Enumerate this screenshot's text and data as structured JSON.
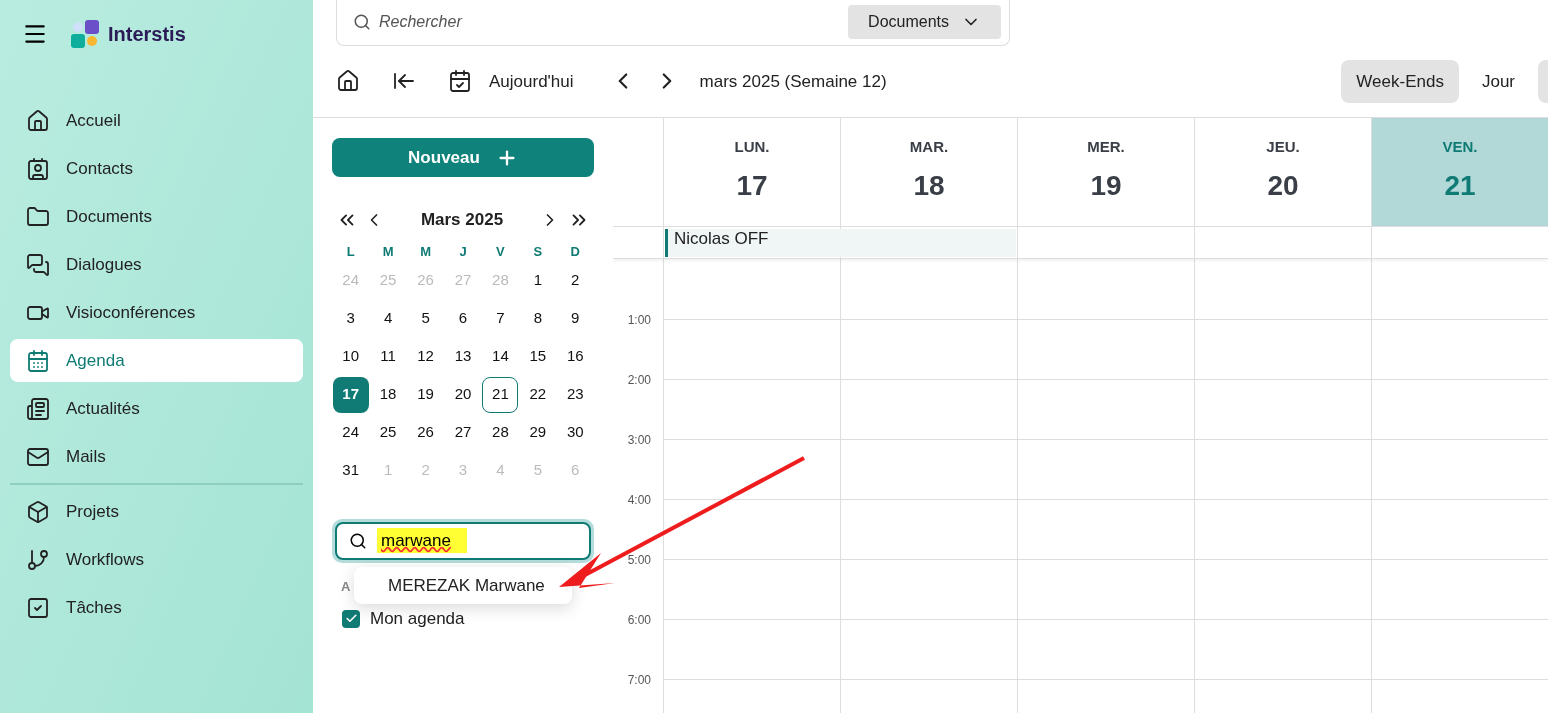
{
  "app": {
    "name": "Interstis"
  },
  "nav": [
    {
      "label": "Accueil",
      "selected": false
    },
    {
      "label": "Contacts",
      "selected": false
    },
    {
      "label": "Documents",
      "selected": false
    },
    {
      "label": "Dialogues",
      "selected": false
    },
    {
      "label": "Visioconférences",
      "selected": false
    },
    {
      "label": "Agenda",
      "selected": true
    },
    {
      "label": "Actualités",
      "selected": false
    },
    {
      "label": "Mails",
      "selected": false
    }
  ],
  "nav_secondary": [
    {
      "label": "Projets",
      "selected": false
    },
    {
      "label": "Workflows",
      "selected": false
    },
    {
      "label": "Tâches",
      "selected": false
    }
  ],
  "search": {
    "placeholder": "Rechercher",
    "scope": "Documents"
  },
  "toolbar": {
    "today": "Aujourd'hui",
    "period": "mars 2025 (Semaine 12)"
  },
  "views": [
    {
      "label": "Week-Ends",
      "selected": true
    },
    {
      "label": "Jour",
      "selected": false
    }
  ],
  "new_button": "Nouveau",
  "mini_calendar": {
    "title": "Mars 2025",
    "weekdays": [
      "L",
      "M",
      "M",
      "J",
      "V",
      "S",
      "D"
    ],
    "days": [
      {
        "label": "24",
        "kind": "other",
        "selected": false,
        "today": false
      },
      {
        "label": "25",
        "kind": "other",
        "selected": false,
        "today": false
      },
      {
        "label": "26",
        "kind": "other",
        "selected": false,
        "today": false
      },
      {
        "label": "27",
        "kind": "other",
        "selected": false,
        "today": false
      },
      {
        "label": "28",
        "kind": "other",
        "selected": false,
        "today": false
      },
      {
        "label": "1",
        "kind": "month",
        "selected": false,
        "today": false
      },
      {
        "label": "2",
        "kind": "month",
        "selected": false,
        "today": false
      },
      {
        "label": "3",
        "kind": "month",
        "selected": false,
        "today": false
      },
      {
        "label": "4",
        "kind": "month",
        "selected": false,
        "today": false
      },
      {
        "label": "5",
        "kind": "month",
        "selected": false,
        "today": false
      },
      {
        "label": "6",
        "kind": "month",
        "selected": false,
        "today": false
      },
      {
        "label": "7",
        "kind": "month",
        "selected": false,
        "today": false
      },
      {
        "label": "8",
        "kind": "month",
        "selected": false,
        "today": false
      },
      {
        "label": "9",
        "kind": "month",
        "selected": false,
        "today": false
      },
      {
        "label": "10",
        "kind": "month",
        "selected": false,
        "today": false
      },
      {
        "label": "11",
        "kind": "month",
        "selected": false,
        "today": false
      },
      {
        "label": "12",
        "kind": "month",
        "selected": false,
        "today": false
      },
      {
        "label": "13",
        "kind": "month",
        "selected": false,
        "today": false
      },
      {
        "label": "14",
        "kind": "month",
        "selected": false,
        "today": false
      },
      {
        "label": "15",
        "kind": "month",
        "selected": false,
        "today": false
      },
      {
        "label": "16",
        "kind": "month",
        "selected": false,
        "today": false
      },
      {
        "label": "17",
        "kind": "month",
        "selected": true,
        "today": false
      },
      {
        "label": "18",
        "kind": "month",
        "selected": false,
        "today": false
      },
      {
        "label": "19",
        "kind": "month",
        "selected": false,
        "today": false
      },
      {
        "label": "20",
        "kind": "month",
        "selected": false,
        "today": false
      },
      {
        "label": "21",
        "kind": "month",
        "selected": false,
        "today": true
      },
      {
        "label": "22",
        "kind": "month",
        "selected": false,
        "today": false
      },
      {
        "label": "23",
        "kind": "month",
        "selected": false,
        "today": false
      },
      {
        "label": "24",
        "kind": "month",
        "selected": false,
        "today": false
      },
      {
        "label": "25",
        "kind": "month",
        "selected": false,
        "today": false
      },
      {
        "label": "26",
        "kind": "month",
        "selected": false,
        "today": false
      },
      {
        "label": "27",
        "kind": "month",
        "selected": false,
        "today": false
      },
      {
        "label": "28",
        "kind": "month",
        "selected": false,
        "today": false
      },
      {
        "label": "29",
        "kind": "month",
        "selected": false,
        "today": false
      },
      {
        "label": "30",
        "kind": "month",
        "selected": false,
        "today": false
      },
      {
        "label": "31",
        "kind": "month",
        "selected": false,
        "today": false
      },
      {
        "label": "1",
        "kind": "other",
        "selected": false,
        "today": false
      },
      {
        "label": "2",
        "kind": "other",
        "selected": false,
        "today": false
      },
      {
        "label": "3",
        "kind": "other",
        "selected": false,
        "today": false
      },
      {
        "label": "4",
        "kind": "other",
        "selected": false,
        "today": false
      },
      {
        "label": "5",
        "kind": "other",
        "selected": false,
        "today": false
      },
      {
        "label": "6",
        "kind": "other",
        "selected": false,
        "today": false
      }
    ]
  },
  "people_search": {
    "value": "marwane",
    "suggestions": [
      "MEREZAK Marwane"
    ]
  },
  "agendas": {
    "heading": "A",
    "items": [
      {
        "label": "Mon agenda",
        "checked": true
      }
    ]
  },
  "days": [
    {
      "weekday": "LUN.",
      "date": "17",
      "selected": false
    },
    {
      "weekday": "MAR.",
      "date": "18",
      "selected": false
    },
    {
      "weekday": "MER.",
      "date": "19",
      "selected": false
    },
    {
      "weekday": "JEU.",
      "date": "20",
      "selected": false
    },
    {
      "weekday": "VEN.",
      "date": "21",
      "selected": true
    }
  ],
  "all_day_events": [
    {
      "title": "Nicolas OFF"
    }
  ],
  "hours": [
    "1:00",
    "2:00",
    "3:00",
    "4:00",
    "5:00",
    "6:00",
    "7:00"
  ]
}
